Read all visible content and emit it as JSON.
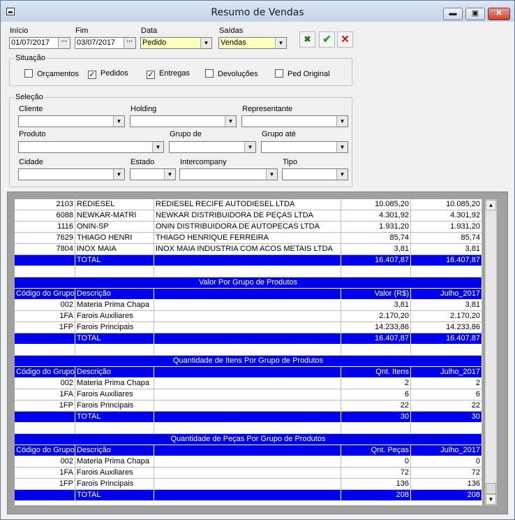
{
  "window": {
    "title": "Resumo de Vendas",
    "min": "▬",
    "max": "▣",
    "close": "✕"
  },
  "top": {
    "inicio": {
      "label": "Início",
      "value": "01/07/2017"
    },
    "fim": {
      "label": "Fim",
      "value": "03/07/2017"
    },
    "data": {
      "label": "Data",
      "value": "Pedido"
    },
    "saidas": {
      "label": "Saídas",
      "value": "Vendas"
    },
    "accent_yellow": "#ffffc0"
  },
  "situacao": {
    "legend": "Situação",
    "items": [
      {
        "label": "Orçamentos",
        "checked": ""
      },
      {
        "label": "Pedidos",
        "checked": "✓"
      },
      {
        "label": "Entregas",
        "checked": "✓"
      },
      {
        "label": "Devoluções",
        "checked": ""
      },
      {
        "label": "Ped Original",
        "checked": ""
      }
    ]
  },
  "selecao": {
    "legend": "Seleção",
    "cliente": "Cliente",
    "holding": "Holding",
    "representante": "Representante",
    "produto": "Produto",
    "grupo_de": "Grupo de",
    "grupo_ate": "Grupo até",
    "cidade": "Cidade",
    "estado": "Estado",
    "intercompany": "Intercompany",
    "tipo": "Tipo"
  },
  "grid": {
    "highlight_color": "#0000ee",
    "clients": [
      {
        "code": "2103",
        "short": "REDIESEL",
        "name": "REDIESEL RECIFE AUTODIESEL LTDA",
        "v1": "10.085,20",
        "v2": "10.085,20"
      },
      {
        "code": "6088",
        "short": "NEWKAR-MATRI",
        "name": "NEWKAR DISTRIBUIDORA DE PEÇAS LTDA",
        "v1": "4.301,92",
        "v2": "4.301,92"
      },
      {
        "code": "1116",
        "short": "ONIN-SP",
        "name": "ONIN DISTRIBUIDORA DE AUTOPECAS LTDA",
        "v1": "1.931,20",
        "v2": "1.931,20"
      },
      {
        "code": "7629",
        "short": "THIAGO HENRI",
        "name": "THIAGO HENRIQUE FERREIRA",
        "v1": "85,74",
        "v2": "85,74"
      },
      {
        "code": "7804",
        "short": "INOX MAIA",
        "name": "INOX MAIA INDUSTRIA COM ACOS METAIS LTDA",
        "v1": "3,81",
        "v2": "3,81"
      }
    ],
    "total1": {
      "label": "TOTAL",
      "v1": "16.407,87",
      "v2": "16.407,87"
    },
    "sections": [
      {
        "title": "Valor Por Grupo de Produtos",
        "headers": [
          "Código do Grupo",
          "Descrição",
          "Valor (R$)",
          "Julho_2017"
        ],
        "rows": [
          {
            "code": "002",
            "desc": "Materia Prima Chapa",
            "v1": "3,81",
            "v2": "3,81"
          },
          {
            "code": "1FA",
            "desc": "Farois Auxiliares",
            "v1": "2.170,20",
            "v2": "2.170,20"
          },
          {
            "code": "1FP",
            "desc": "Farois Principais",
            "v1": "14.233,86",
            "v2": "14.233,86"
          }
        ],
        "total": {
          "label": "TOTAL",
          "v1": "16.407,87",
          "v2": "16.407,87"
        }
      },
      {
        "title": "Quantidade de Itens Por Grupo de Produtos",
        "headers": [
          "Código do Grupo",
          "Descrição",
          "Qnt. Itens",
          "Julho_2017"
        ],
        "rows": [
          {
            "code": "002",
            "desc": "Materia Prima Chapa",
            "v1": "2",
            "v2": "2"
          },
          {
            "code": "1FA",
            "desc": "Farois Auxiliares",
            "v1": "6",
            "v2": "6"
          },
          {
            "code": "1FP",
            "desc": "Farois Principais",
            "v1": "22",
            "v2": "22"
          }
        ],
        "total": {
          "label": "TOTAL",
          "v1": "30",
          "v2": "30"
        }
      },
      {
        "title": "Quantidade de Peças Por Grupo de Produtos",
        "headers": [
          "Código do Grupo",
          "Descrição",
          "Qnt. Peças",
          "Julho_2017"
        ],
        "rows": [
          {
            "code": "002",
            "desc": "Materia Prima Chapa",
            "v1": "0",
            "v2": "0"
          },
          {
            "code": "1FA",
            "desc": "Farois Auxiliares",
            "v1": "72",
            "v2": "72"
          },
          {
            "code": "1FP",
            "desc": "Farois Principais",
            "v1": "136",
            "v2": "136"
          }
        ],
        "total": {
          "label": "TOTAL",
          "v1": "208",
          "v2": "208"
        }
      }
    ]
  }
}
